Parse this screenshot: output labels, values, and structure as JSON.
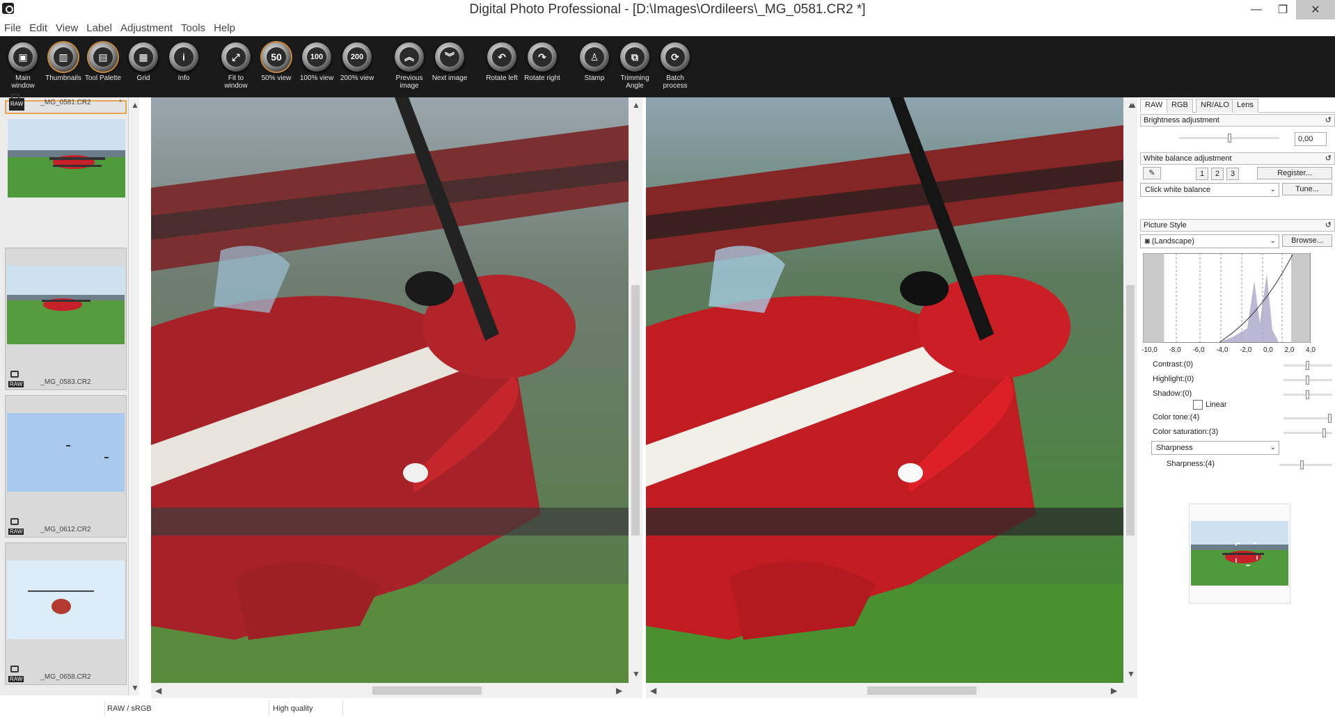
{
  "window": {
    "title": "Digital Photo Professional - [D:\\Images\\Ordileers\\_MG_0581.CR2 *]"
  },
  "menu": [
    "File",
    "Edit",
    "View",
    "Label",
    "Adjustment",
    "Tools",
    "Help"
  ],
  "toolbar": [
    {
      "label": "Main window",
      "glyph": "▣"
    },
    {
      "label": "Thumbnails",
      "glyph": "▥"
    },
    {
      "label": "Tool Palette",
      "glyph": "▤"
    },
    {
      "label": "Grid",
      "glyph": "▦"
    },
    {
      "label": "Info",
      "glyph": "i"
    },
    {
      "label": "Fit to window",
      "glyph": "⤢"
    },
    {
      "label": "50% view",
      "glyph": "50"
    },
    {
      "label": "100% view",
      "glyph": "100"
    },
    {
      "label": "200% view",
      "glyph": "200"
    },
    {
      "label": "Previous image",
      "glyph": "︽"
    },
    {
      "label": "Next image",
      "glyph": "︾"
    },
    {
      "label": "Rotate left",
      "glyph": "↶"
    },
    {
      "label": "Rotate right",
      "glyph": "↷"
    },
    {
      "label": "Stamp",
      "glyph": "♙"
    },
    {
      "label": "Trimming Angle",
      "glyph": "⧉"
    },
    {
      "label": "Batch process",
      "glyph": "⟳"
    }
  ],
  "thumbnails": [
    {
      "name": "_MG_0581.CR2",
      "badge": "RAW",
      "mark": "*"
    },
    {
      "name": "_MG_0583.CR2",
      "badge": "RAW",
      "mark": ""
    },
    {
      "name": "_MG_0612.CR2",
      "badge": "RAW",
      "mark": ""
    },
    {
      "name": "_MG_0658.CR2",
      "badge": "RAW",
      "mark": ""
    }
  ],
  "panel": {
    "tabs": [
      "RAW",
      "RGB",
      "NR/ALO",
      "Lens"
    ],
    "brightness": {
      "title": "Brightness adjustment",
      "value": "0,00"
    },
    "white_balance": {
      "title": "White balance adjustment",
      "slots": [
        "1",
        "2",
        "3"
      ],
      "register": "Register...",
      "mode": "Click white balance",
      "tune": "Tune..."
    },
    "picture_style": {
      "title": "Picture Style",
      "style": "(Landscape)",
      "browse": "Browse...",
      "axis": [
        "-10,0",
        "-8,0",
        "-6,0",
        "-4,0",
        "-2,0",
        "0,0",
        "2,0",
        "4,0"
      ]
    },
    "contrast": "Contrast:(0)",
    "highlight": "Highlight:(0)",
    "shadow": "Shadow:(0)",
    "linear": "Linear",
    "color_tone": "Color tone:(4)",
    "color_saturation": "Color saturation:(3)",
    "sharpness_mode": "Sharpness",
    "sharpness": "Sharpness:(4)"
  },
  "status": {
    "color_space": "RAW / sRGB",
    "quality": "High quality"
  }
}
